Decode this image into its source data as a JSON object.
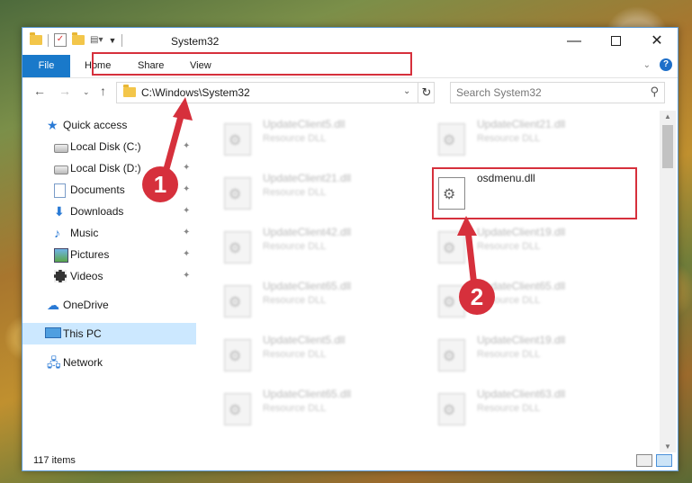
{
  "window": {
    "title": "System32",
    "controls": {
      "minimize": "—",
      "maximize": "",
      "close": "✕"
    }
  },
  "ribbon": {
    "tabs": [
      "File",
      "Home",
      "Share",
      "View"
    ],
    "expand_glyph": "⌄",
    "help_glyph": "?"
  },
  "address": {
    "path": "C:\\Windows\\System32",
    "refresh_glyph": "↻",
    "dropdown_glyph": "⌄"
  },
  "search": {
    "placeholder": "Search System32",
    "icon_glyph": "⚲"
  },
  "nav": {
    "back": "←",
    "forward": "→",
    "recent": "⌄",
    "up": "↑"
  },
  "sidebar": {
    "items": [
      {
        "label": "Quick access",
        "icon": "star-icon"
      },
      {
        "label": "Local Disk (C:)",
        "icon": "disk-icon",
        "pinned": true
      },
      {
        "label": "Local Disk (D:)",
        "icon": "disk-icon",
        "pinned": true
      },
      {
        "label": "Documents",
        "icon": "documents-icon",
        "pinned": true
      },
      {
        "label": "Downloads",
        "icon": "downloads-icon",
        "pinned": true
      },
      {
        "label": "Music",
        "icon": "music-icon",
        "pinned": true
      },
      {
        "label": "Pictures",
        "icon": "pictures-icon",
        "pinned": true
      },
      {
        "label": "Videos",
        "icon": "videos-icon",
        "pinned": true
      },
      {
        "label": "OneDrive",
        "icon": "cloud-icon"
      },
      {
        "label": "This PC",
        "icon": "pc-icon",
        "selected": true
      },
      {
        "label": "Network",
        "icon": "network-icon"
      }
    ],
    "pin_glyph": "📌"
  },
  "files": [
    {
      "name": "UpdateClient5.dll",
      "type": "Resource DLL"
    },
    {
      "name": "UpdateClient21.dll",
      "type": "Resource DLL"
    },
    {
      "name": "UpdateClient21.dll",
      "type": "Resource DLL"
    },
    {
      "name": "osdmenu.dll",
      "type": ""
    },
    {
      "name": "UpdateClient42.dll",
      "type": "Resource DLL"
    },
    {
      "name": "UpdateClient19.dll",
      "type": "Resource DLL"
    },
    {
      "name": "UpdateClient65.dll",
      "type": "Resource DLL"
    },
    {
      "name": "UpdateClient65.dll",
      "type": "Resource DLL"
    },
    {
      "name": "UpdateClient5.dll",
      "type": "Resource DLL"
    },
    {
      "name": "UpdateClient19.dll",
      "type": "Resource DLL"
    },
    {
      "name": "UpdateClient65.dll",
      "type": "Resource DLL"
    },
    {
      "name": "UpdateClient63.dll",
      "type": "Resource DLL"
    }
  ],
  "status": {
    "item_count": "117 items"
  },
  "annotations": {
    "step1": "1",
    "step2": "2",
    "color": "#d6303c"
  }
}
